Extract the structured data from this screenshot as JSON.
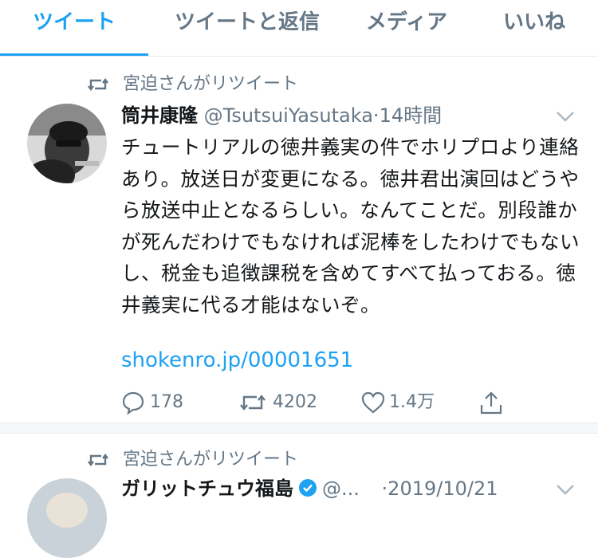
{
  "tabs": [
    {
      "label": "ツイート",
      "active": true
    },
    {
      "label": "ツイートと返信",
      "active": false
    },
    {
      "label": "メディア",
      "active": false
    },
    {
      "label": "いいね",
      "active": false
    }
  ],
  "tweets": [
    {
      "retweet_context": "宮迫さんがリツイート",
      "display_name": "筒井康隆",
      "handle": "@TsutsuiYasutaka",
      "separator": "·",
      "time": "14時間",
      "text": "チュートリアルの徳井義実の件でホリプロより連絡あり。放送日が変更になる。徳井君出演回はどうやら放送中止となるらしい。なんてことだ。別段誰かが死んだわけでもなければ泥棒をしたわけでもないし、税金も追徴課税を含めてすべて払っておる。徳井義実に代る才能はないぞ。",
      "link": "shokenro.jp/00001651",
      "replies": "178",
      "retweets": "4202",
      "likes": "1.4万",
      "icons": [
        "retweet-icon",
        "reply-icon",
        "like-icon",
        "share-icon",
        "chevron-down-icon"
      ]
    },
    {
      "retweet_context": "宮迫さんがリツイート",
      "display_name": "ガリットチュウ福島",
      "handle": "@...",
      "separator": "·",
      "time": "2019/10/21",
      "verified": true
    }
  ],
  "colors": {
    "accent": "#1da1f2",
    "secondary_text": "#657786",
    "primary_text": "#14171a",
    "divider": "#e6ecf0"
  }
}
